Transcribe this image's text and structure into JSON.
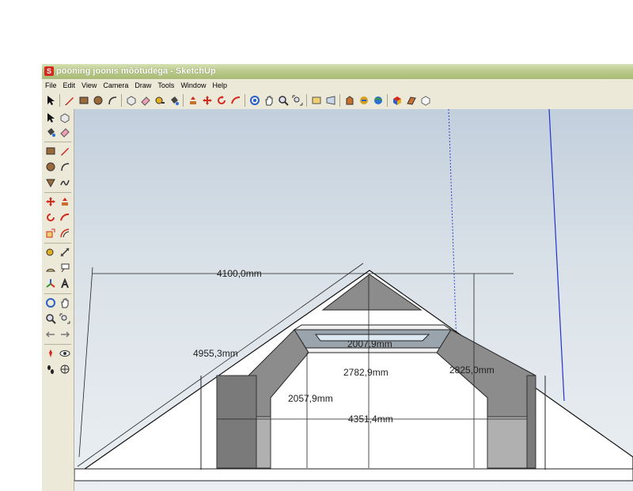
{
  "window": {
    "title": "pööning joonis mõõtudega - SketchUp"
  },
  "menu": [
    "File",
    "Edit",
    "View",
    "Camera",
    "Draw",
    "Tools",
    "Window",
    "Help"
  ],
  "dimensions": {
    "top_width": "4100,0mm",
    "slope_length": "4955,3mm",
    "ridge_height": "2782,9mm",
    "right_height": "2825,0mm",
    "inner_wall_height": "2057,9mm",
    "inner_width": "4351,4mm",
    "window_width": "2007,9mm"
  },
  "colors": {
    "title_bar": "#bccb8c",
    "viewport_sky": "#c2cfdc",
    "wall_shade": "#8a8a8a",
    "roof_face": "#ffffff",
    "axis_blue": "#2233cc"
  }
}
